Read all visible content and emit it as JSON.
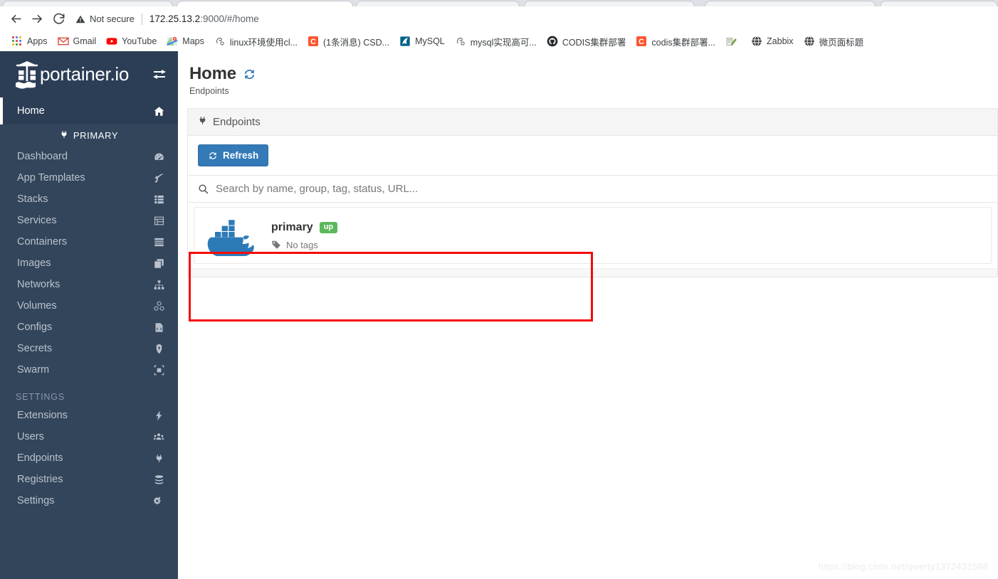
{
  "browser": {
    "nav": {
      "back_label": "Back",
      "forward_label": "Forward",
      "reload_label": "Reload"
    },
    "omnibox": {
      "security_label": "Not secure",
      "url_host": "172.25.13.2",
      "url_rest": ":9000/#/home"
    },
    "bookmarks": [
      {
        "label": "Apps",
        "icon": "apps-grid-icon"
      },
      {
        "label": "Gmail",
        "icon": "gmail-icon"
      },
      {
        "label": "YouTube",
        "icon": "youtube-icon"
      },
      {
        "label": "Maps",
        "icon": "maps-icon"
      },
      {
        "label": "linux环境使用cl...",
        "icon": "generic-page-icon"
      },
      {
        "label": "(1条消息) CSD...",
        "icon": "csdn-icon"
      },
      {
        "label": "MySQL",
        "icon": "mysql-dolphin-icon"
      },
      {
        "label": "mysql实现高可...",
        "icon": "generic-page-icon"
      },
      {
        "label": "CODIS集群部署",
        "icon": "github-icon"
      },
      {
        "label": "codis集群部署...",
        "icon": "csdn-icon"
      },
      {
        "label": "",
        "icon": "notepad-icon"
      },
      {
        "label": "Zabbix",
        "icon": "globe-icon"
      },
      {
        "label": "微页面标题",
        "icon": "globe-icon"
      }
    ]
  },
  "sidebar": {
    "brand": "portainer.io",
    "toggle_icon": "collapse-sidebar-icon",
    "home": {
      "label": "Home",
      "icon": "home-icon"
    },
    "primary_group": {
      "label": "PRIMARY",
      "icon": "plug-icon"
    },
    "items": [
      {
        "label": "Dashboard",
        "icon": "dashboard-icon"
      },
      {
        "label": "App Templates",
        "icon": "rocket-icon"
      },
      {
        "label": "Stacks",
        "icon": "stacks-icon"
      },
      {
        "label": "Services",
        "icon": "services-icon"
      },
      {
        "label": "Containers",
        "icon": "containers-icon"
      },
      {
        "label": "Images",
        "icon": "images-icon"
      },
      {
        "label": "Networks",
        "icon": "networks-icon"
      },
      {
        "label": "Volumes",
        "icon": "volumes-icon"
      },
      {
        "label": "Configs",
        "icon": "configs-icon"
      },
      {
        "label": "Secrets",
        "icon": "secrets-icon"
      },
      {
        "label": "Swarm",
        "icon": "swarm-icon"
      }
    ],
    "settings_header": "SETTINGS",
    "settings_items": [
      {
        "label": "Extensions",
        "icon": "bolt-icon"
      },
      {
        "label": "Users",
        "icon": "users-icon"
      },
      {
        "label": "Endpoints",
        "icon": "plug-icon"
      },
      {
        "label": "Registries",
        "icon": "registries-icon"
      },
      {
        "label": "Settings",
        "icon": "gears-icon"
      }
    ]
  },
  "main": {
    "title": "Home",
    "title_refresh_icon": "refresh-icon",
    "subtitle": "Endpoints",
    "panel": {
      "header": "Endpoints",
      "header_icon": "plug-icon",
      "refresh_button": "Refresh",
      "refresh_button_icon": "refresh-icon",
      "search_placeholder": "Search by name, group, tag, status, URL...",
      "search_value": "",
      "search_icon": "search-icon"
    },
    "endpoints": [
      {
        "name": "primary",
        "status": "up",
        "tags": "No tags",
        "tags_icon": "tag-icon",
        "logo": "docker-whale-icon"
      }
    ]
  },
  "annotation": {
    "highlight_color": "#f40b0b"
  },
  "watermark": "https://blog.csdn.net/qwerty1372431588",
  "colors": {
    "sidebar_bg": "#33455b",
    "sidebar_active_bg": "#2c3e55",
    "primary_blue": "#337ab7",
    "status_up_green": "#5cb85c",
    "docker_blue": "#2d7bb6"
  }
}
